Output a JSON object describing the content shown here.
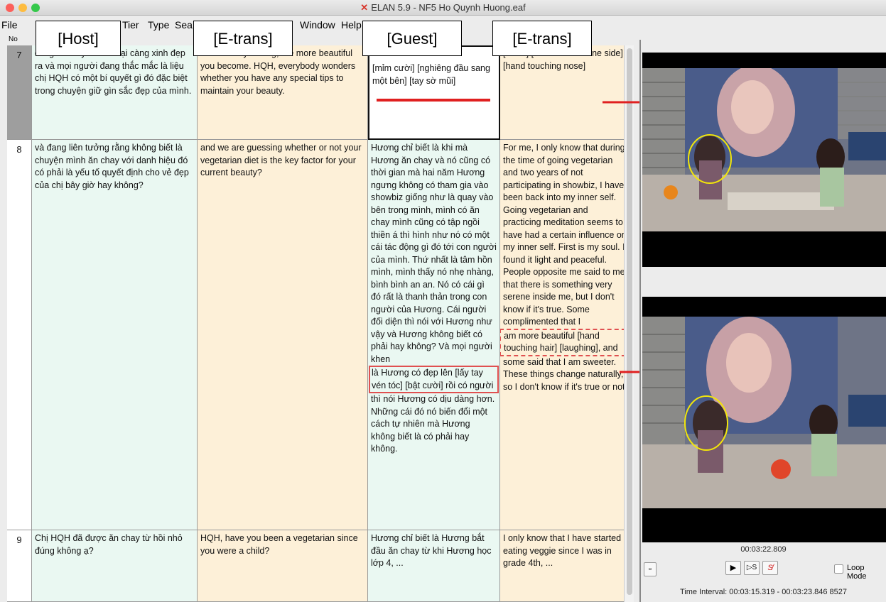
{
  "window": {
    "title": "ELAN 5.9 - NF5 Ho Quynh Huong.eaf"
  },
  "menu": {
    "file": "File",
    "tier": "Tier",
    "type": "Type",
    "search": "Sea",
    "window": "Window",
    "help": "Help"
  },
  "table": {
    "no_header": "No"
  },
  "overlay_labels": [
    "[Host]",
    "[E-trans]",
    "[Guest]",
    "[E-trans]"
  ],
  "rows": [
    {
      "no": "7",
      "host": "càng hát hay hơn thì lại càng xinh đẹp ra và mọi người đang thắc mắc là liệu chị HQH có một bí quyết gì đó đặc biệt trong chuyện giữ gìn sắc đẹp của mình.",
      "host_trans": "The better you sing, the more beautiful you become. HQH, everybody wonders whether you have any special tips to maintain your beauty.",
      "guest": "[mỉm cười] [nghiêng đầu sang một bên] [tay sờ mũi]",
      "guest_trans": "[smile] [head titled to one side] [hand touching nose]"
    },
    {
      "no": "8",
      "host": "và đang liên tưởng rằng  không biết là chuyện mình ăn chay với danh hiệu đó có phải là yếu tố quyết định cho vẻ đẹp của chị bây giờ hay không?",
      "host_trans": "and we are guessing whether or not your vegetarian diet is the key factor for your current beauty?",
      "guest_a": "Hương chỉ biết là khi mà Hương ăn chay và nó cũng có thời gian mà hai năm Hương ngưng không có tham gia vào showbiz giống như là quay vào bên trong mình, mình có ăn chay mình cũng có tập ngồi thiền á thì hình như nó có một cái tác động gì đó tới con người của mình. Thứ nhất là tâm hồn mình, mình thấy nó nhẹ nhàng, bình bình an an. Nó có cái gì đó rất là thanh thản trong con người của Hương. Cái người đối diện thì nói với Hương như vậy và Hương không biết có phải hay không? Và mọi người khen",
      "guest_b": "là Hương có đẹp lên [lấy tay vén tóc] [bật cười] rồi có người",
      "guest_c": "thì nói Hương có dịu dàng hơn. Những cái đó nó biến đổi một cách tự nhiên mà Hương không biết là có phải hay không.",
      "guest_trans_a": "For me, I only know that during the time of going vegetarian and two years of not participating in showbiz, I have been back into my inner self. Going vegetarian and practicing meditation seems to have had a certain influence on my inner self. First is my soul. I found it light and peaceful. People opposite me said to me that there is something very serene inside me, but I don't know if it's true. Some complimented that I",
      "guest_trans_b": "am more beautiful [hand touching hair] [laughing], and",
      "guest_trans_c": "some said that I am sweeter. These things change naturally, so I don't know if it's true or not."
    },
    {
      "no": "9",
      "host": "Chị HQH đã được ăn chay từ hồi nhỏ đúng không ạ?",
      "host_trans": "HQH, have you been a vegetarian since you were a child?",
      "guest": "Hương chỉ biết là Hương bắt đầu ăn chay từ khi Hương học lớp 4, ...",
      "guest_trans": "I only know that I have started eating veggie since I was in grade 4th, ..."
    }
  ],
  "player": {
    "current_time": "00:03:22.809",
    "selection_button": "S",
    "loop_mode": "Loop Mode",
    "time_interval": "Time Interval: 00:03:15.319 - 00:03:23.846  8527"
  },
  "colors": {
    "host_bg": "#eaf8f2",
    "trans_bg": "#fdf0d8",
    "highlight_red": "#e02020",
    "circle_yellow": "#f2e60a"
  }
}
